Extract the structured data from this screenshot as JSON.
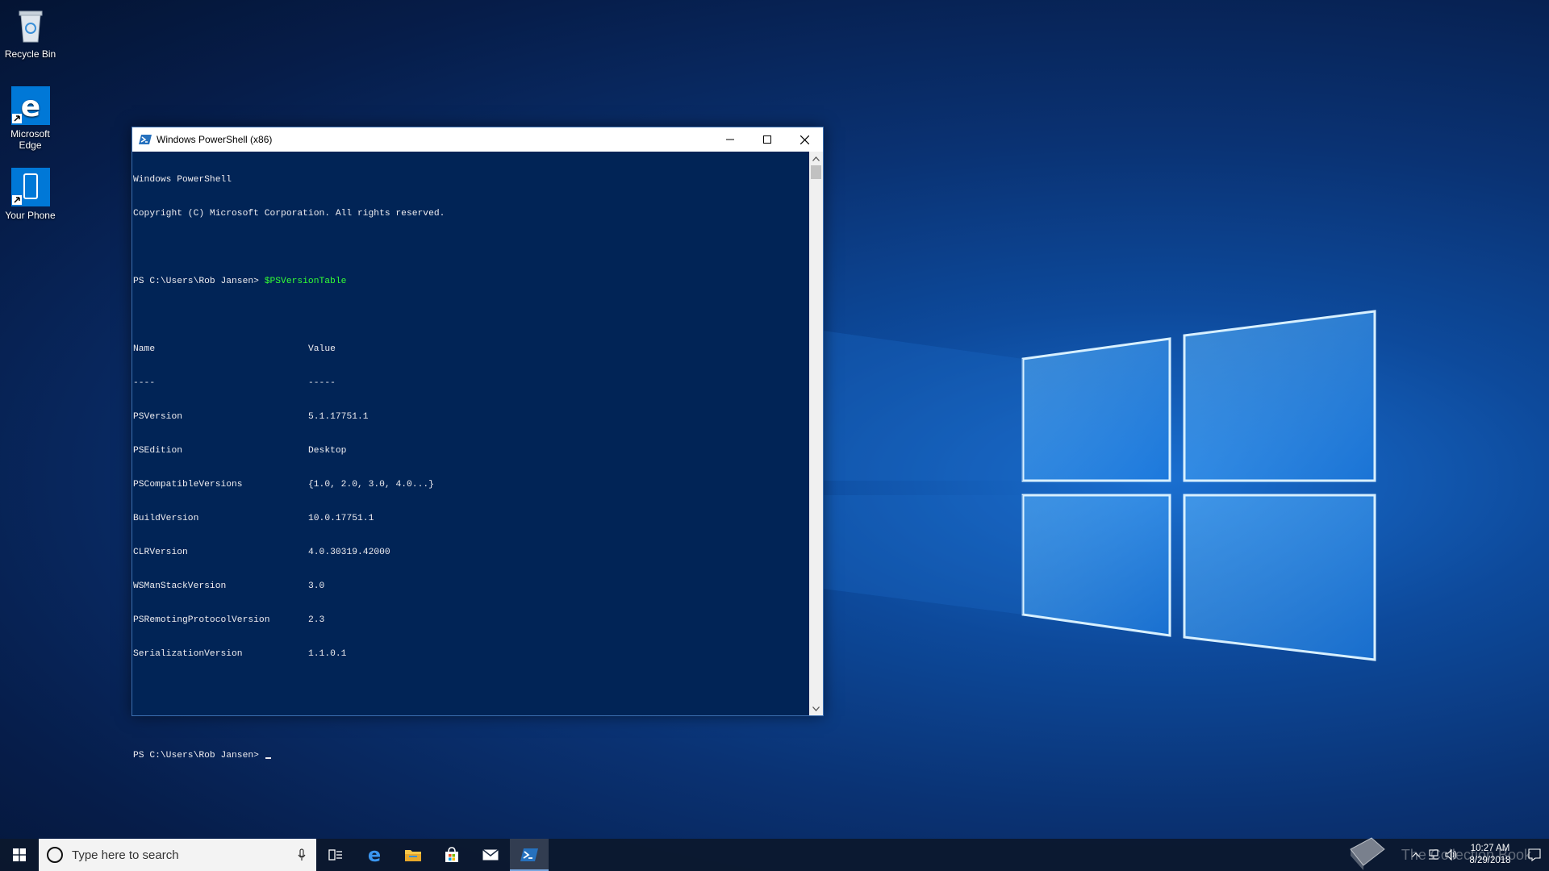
{
  "desktop": {
    "icons": [
      {
        "label": "Recycle Bin",
        "icon": "recycle-bin-icon"
      },
      {
        "label": "Microsoft Edge",
        "icon": "edge-icon"
      },
      {
        "label": "Your Phone",
        "icon": "phone-icon"
      }
    ]
  },
  "window": {
    "title": "Windows PowerShell (x86)",
    "icon": "powershell-icon",
    "buttons": {
      "minimize": "minimize-icon",
      "maximize": "maximize-icon",
      "close": "close-icon"
    }
  },
  "console": {
    "header1": "Windows PowerShell",
    "header2": "Copyright (C) Microsoft Corporation. All rights reserved.",
    "prompt1": "PS C:\\Users\\Rob Jansen> ",
    "command1": "$PSVersionTable",
    "col_name": "Name",
    "col_value": "Value",
    "col_name_rule": "----",
    "col_value_rule": "-----",
    "rows": [
      {
        "name": "PSVersion",
        "value": "5.1.17751.1"
      },
      {
        "name": "PSEdition",
        "value": "Desktop"
      },
      {
        "name": "PSCompatibleVersions",
        "value": "{1.0, 2.0, 3.0, 4.0...}"
      },
      {
        "name": "BuildVersion",
        "value": "10.0.17751.1"
      },
      {
        "name": "CLRVersion",
        "value": "4.0.30319.42000"
      },
      {
        "name": "WSManStackVersion",
        "value": "3.0"
      },
      {
        "name": "PSRemotingProtocolVersion",
        "value": "2.3"
      },
      {
        "name": "SerializationVersion",
        "value": "1.1.0.1"
      }
    ],
    "prompt2": "PS C:\\Users\\Rob Jansen> "
  },
  "taskbar": {
    "search_placeholder": "Type here to search",
    "apps": [
      "task-view-icon",
      "edge-icon",
      "file-explorer-icon",
      "store-icon",
      "mail-icon",
      "powershell-icon"
    ],
    "clock_time": "10:27 AM",
    "clock_date": "8/29/2018",
    "watermark": "The Collection Book"
  },
  "colors": {
    "console_bg": "#012456",
    "console_fg": "#eeedf0",
    "command": "#33ff33"
  }
}
